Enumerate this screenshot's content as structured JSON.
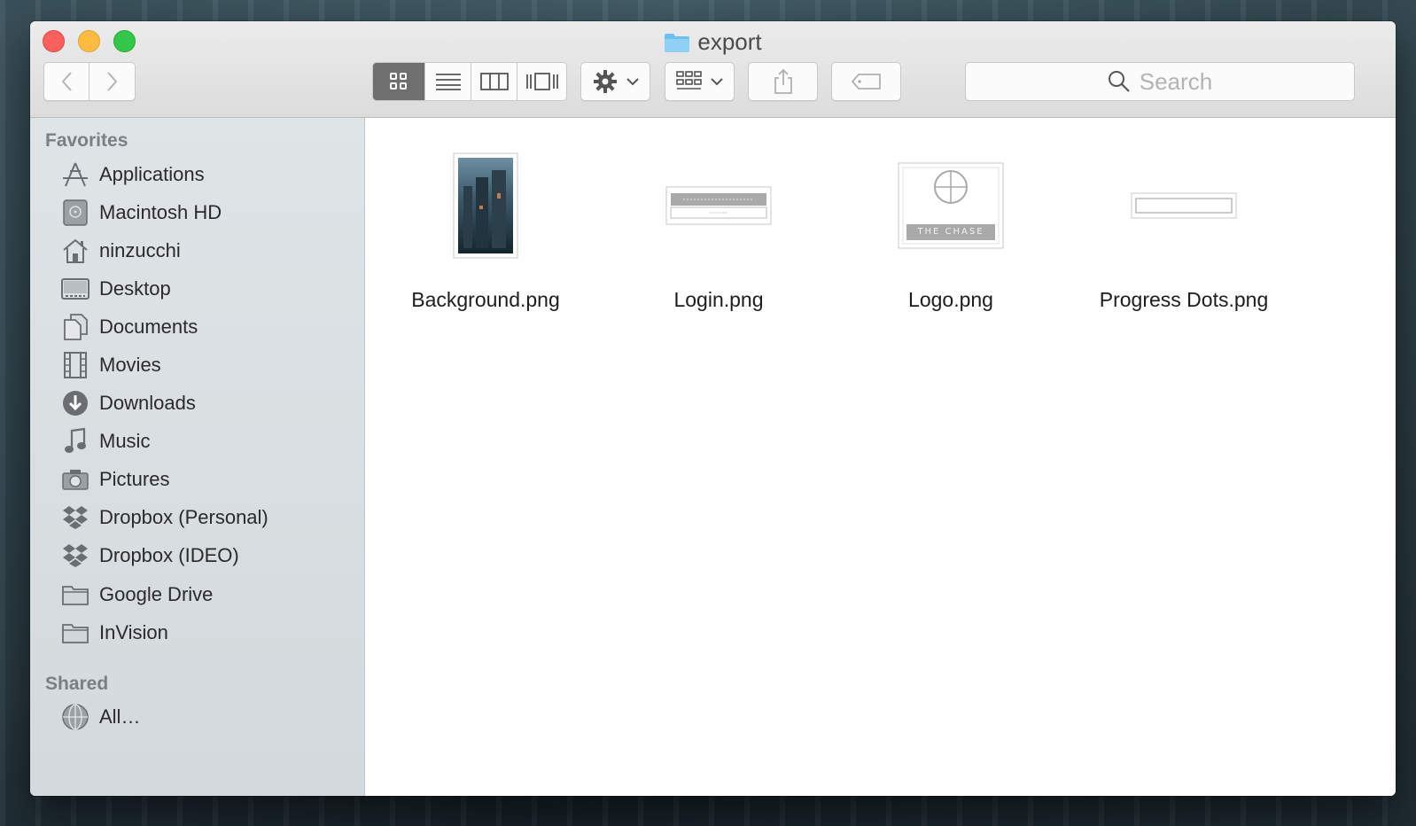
{
  "window": {
    "title": "export"
  },
  "toolbar": {
    "search_placeholder": "Search"
  },
  "sidebar": {
    "favorites_heading": "Favorites",
    "favorites": [
      {
        "label": "Applications",
        "icon": "applications-icon"
      },
      {
        "label": "Macintosh HD",
        "icon": "hard-drive-icon"
      },
      {
        "label": "ninzucchi",
        "icon": "home-icon"
      },
      {
        "label": "Desktop",
        "icon": "desktop-icon"
      },
      {
        "label": "Documents",
        "icon": "documents-icon"
      },
      {
        "label": "Movies",
        "icon": "film-icon"
      },
      {
        "label": "Downloads",
        "icon": "download-icon"
      },
      {
        "label": "Music",
        "icon": "music-note-icon"
      },
      {
        "label": "Pictures",
        "icon": "camera-icon"
      },
      {
        "label": "Dropbox (Personal)",
        "icon": "dropbox-icon"
      },
      {
        "label": "Dropbox (IDEO)",
        "icon": "dropbox-icon"
      },
      {
        "label": "Google Drive",
        "icon": "folder-icon"
      },
      {
        "label": "InVision",
        "icon": "folder-icon"
      }
    ],
    "shared_heading": "Shared",
    "shared": [
      {
        "label": "All…",
        "icon": "network-globe-icon"
      }
    ]
  },
  "files": [
    {
      "name": "Background.png"
    },
    {
      "name": "Login.png"
    },
    {
      "name": "Logo.png",
      "thumb_text": "THE CHASE"
    },
    {
      "name": "Progress Dots.png"
    }
  ],
  "colors": {
    "close": "#fc605c",
    "minimize": "#fdbc40",
    "maximize": "#34c84a",
    "folder_blue": "#6cc0f0",
    "sidebar_bg": "#dfe4e7"
  }
}
